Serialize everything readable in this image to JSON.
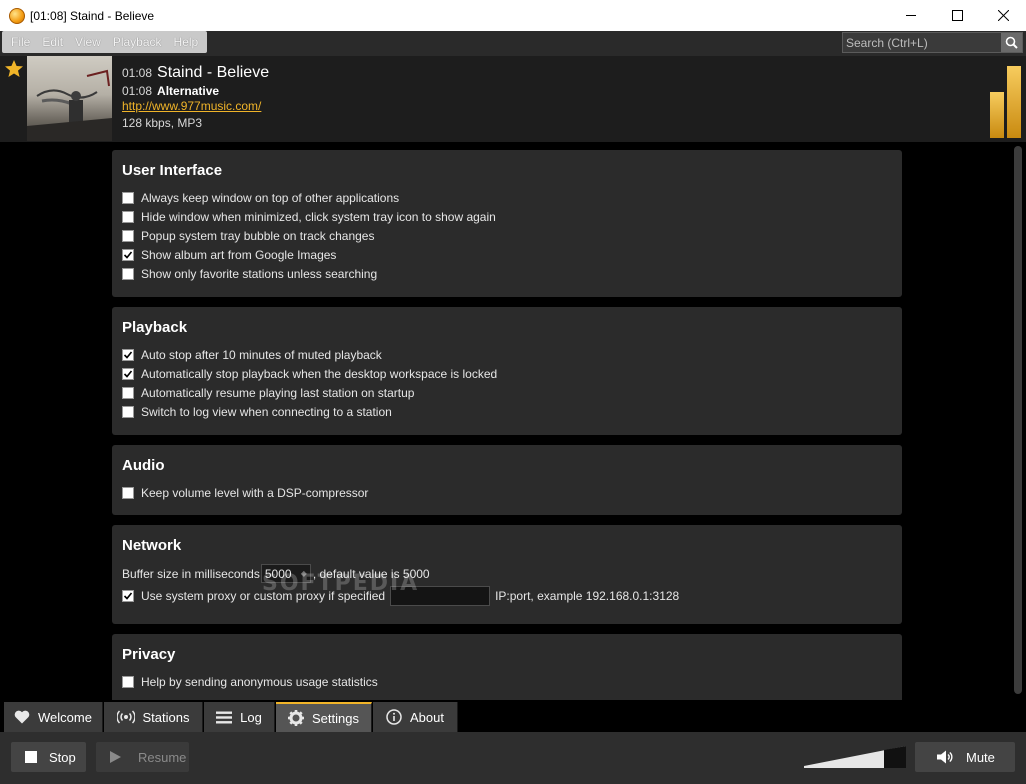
{
  "window": {
    "title": "[01:08] Staind - Believe"
  },
  "menu": {
    "items": [
      "File",
      "Edit",
      "View",
      "Playback",
      "Help"
    ]
  },
  "search": {
    "placeholder": "Search (Ctrl+L)"
  },
  "now_playing": {
    "track_time": "01:08",
    "track_title": "Staind - Believe",
    "station_time": "01:08",
    "station_genre": "Alternative",
    "station_url": "http://www.977music.com/",
    "bitrate": "128 kbps, MP3",
    "favorite": true
  },
  "sections": {
    "user_interface": {
      "title": "User Interface",
      "options": [
        {
          "label": "Always keep window on top of other applications",
          "checked": false
        },
        {
          "label": "Hide window when minimized, click system tray icon to show again",
          "checked": false
        },
        {
          "label": "Popup system tray bubble on track changes",
          "checked": false
        },
        {
          "label": "Show album art from Google Images",
          "checked": true
        },
        {
          "label": "Show only favorite stations unless searching",
          "checked": false
        }
      ]
    },
    "playback": {
      "title": "Playback",
      "options": [
        {
          "label": "Auto stop after 10 minutes of muted playback",
          "checked": true
        },
        {
          "label": "Automatically stop playback when the desktop workspace is locked",
          "checked": true
        },
        {
          "label": "Automatically resume playing last station on startup",
          "checked": false
        },
        {
          "label": "Switch to log view when connecting to a station",
          "checked": false
        }
      ]
    },
    "audio": {
      "title": "Audio",
      "options": [
        {
          "label": "Keep volume level with a DSP-compressor",
          "checked": false
        }
      ]
    },
    "network": {
      "title": "Network",
      "buffer_label": "Buffer size in milliseconds",
      "buffer_value": "5000",
      "buffer_default": ", default value is 5000",
      "proxy_label": "Use system proxy or custom proxy if specified",
      "proxy_checked": true,
      "proxy_value": "",
      "proxy_hint": "IP:port, example 192.168.0.1:3128"
    },
    "privacy": {
      "title": "Privacy",
      "options": [
        {
          "label": "Help by sending anonymous usage statistics",
          "checked": false
        }
      ]
    }
  },
  "tabs": [
    {
      "label": "Welcome",
      "icon": "heart-icon",
      "active": false
    },
    {
      "label": "Stations",
      "icon": "broadcast-icon",
      "active": false
    },
    {
      "label": "Log",
      "icon": "list-icon",
      "active": false
    },
    {
      "label": "Settings",
      "icon": "gear-icon",
      "active": true
    },
    {
      "label": "About",
      "icon": "info-icon",
      "active": false
    }
  ],
  "controls": {
    "stop_label": "Stop",
    "resume_label": "Resume",
    "mute_label": "Mute"
  },
  "watermark": "SOFTPEDIA",
  "colors": {
    "accent": "#f0b429",
    "panel": "#2b2b2b",
    "background": "#000000"
  }
}
